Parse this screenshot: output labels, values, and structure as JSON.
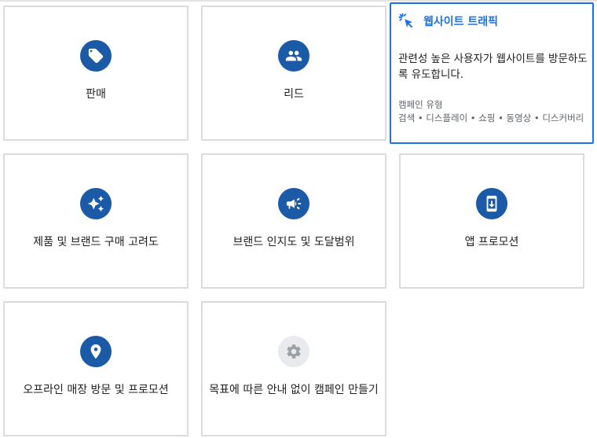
{
  "goals": {
    "sales": {
      "label": "판매",
      "icon": "tag-icon"
    },
    "leads": {
      "label": "리드",
      "icon": "people-icon"
    },
    "traffic": {
      "title": "웹사이트 트래픽",
      "icon": "click-cursor-icon",
      "description": "관련성 높은 사용자가 웹사이트를 방문하도록 유도합니다.",
      "campaign_types_label": "캠페인 유형",
      "campaign_types": "검색 • 디스플레이 • 쇼핑 • 동영상 • 디스커버리"
    },
    "consideration": {
      "label": "제품 및 브랜드 구매 고려도",
      "icon": "sparkle-icon"
    },
    "awareness": {
      "label": "브랜드 인지도 및 도달범위",
      "icon": "megaphone-icon"
    },
    "app": {
      "label": "앱 프로모션",
      "icon": "phone-download-icon"
    },
    "store": {
      "label": "오프라인 매장 방문 및 프로모션",
      "icon": "location-pin-icon"
    },
    "no_goal": {
      "label": "목표에 따른 안내 없이 캠페인 만들기",
      "icon": "gear-icon"
    }
  },
  "colors": {
    "accent": "#1a73e8",
    "icon_bg": "#1a5aa6",
    "border": "#dadce0"
  }
}
